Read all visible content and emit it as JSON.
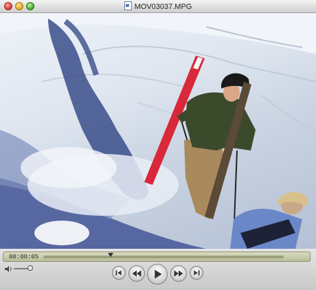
{
  "window": {
    "title": "MOV03037.MPG"
  },
  "player": {
    "timecode": "00:00:05",
    "progress_fraction": 0.28,
    "volume_fraction": 0.85
  },
  "icons": {
    "file": "movie-file-icon",
    "volume": "speaker-icon",
    "go_to_start": "skip-to-start-icon",
    "rewind": "rewind-icon",
    "play": "play-icon",
    "fast_forward": "fast-forward-icon",
    "go_to_end": "skip-to-end-icon"
  },
  "colors": {
    "ski": "#d8283a",
    "jacket": "#3c4a2c",
    "helmet": "#1a1a1a",
    "snow_shadow": "#3a4d8a",
    "jacket2": "#6a88c8"
  }
}
